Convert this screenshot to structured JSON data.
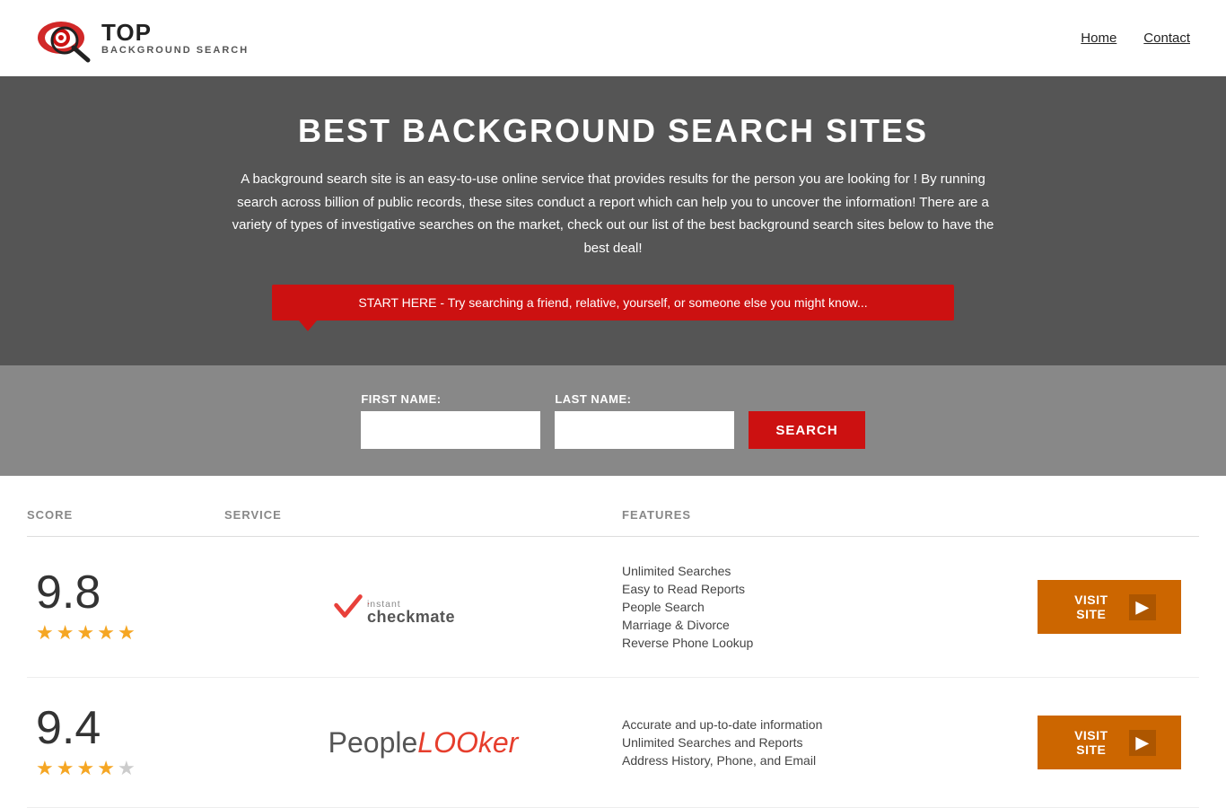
{
  "header": {
    "logo_top": "TOP",
    "logo_sub": "BACKGROUND SEARCH",
    "nav": [
      {
        "label": "Home",
        "href": "#"
      },
      {
        "label": "Contact",
        "href": "#"
      }
    ]
  },
  "hero": {
    "title": "BEST BACKGROUND SEARCH SITES",
    "description": "A background search site is an easy-to-use online service that provides results  for the person you are looking for ! By  running  search across billion of public records, these sites conduct  a report which can help you to uncover the information! There are a variety of types of investigative searches on the market, check out our  list of the best background search sites below to have the best deal!",
    "callout": "START HERE - Try searching a friend, relative, yourself, or someone else you might know..."
  },
  "search": {
    "first_name_label": "FIRST NAME:",
    "last_name_label": "LAST NAME:",
    "button_label": "SEARCH"
  },
  "table": {
    "headers": {
      "score": "SCORE",
      "service": "SERVICE",
      "features": "FEATURES"
    },
    "rows": [
      {
        "score": "9.8",
        "stars": 4.5,
        "service_name": "Instant Checkmate",
        "features": [
          "Unlimited Searches",
          "Easy to Read Reports",
          "People Search",
          "Marriage & Divorce",
          "Reverse Phone Lookup"
        ],
        "visit_label": "VISIT SITE"
      },
      {
        "score": "9.4",
        "stars": 4,
        "service_name": "PeopleLooker",
        "features": [
          "Accurate and up-to-date information",
          "Unlimited Searches and Reports",
          "Address History, Phone, and Email"
        ],
        "visit_label": "VISIT SITE"
      }
    ]
  }
}
